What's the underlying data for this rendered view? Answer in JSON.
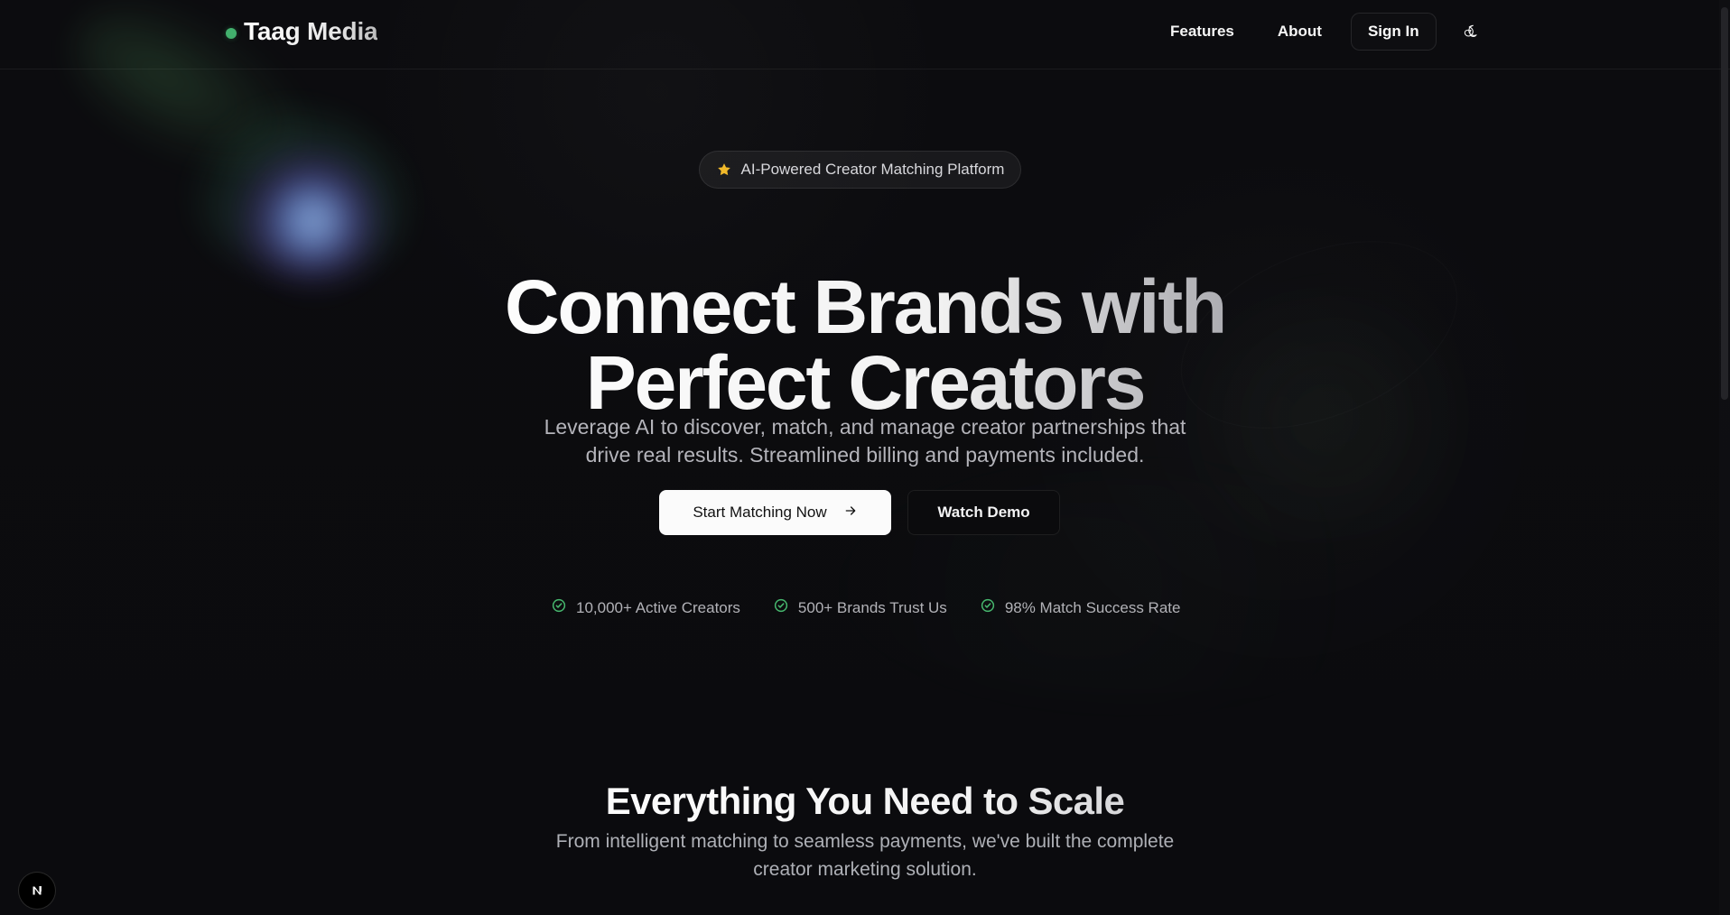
{
  "header": {
    "brand": "Taag Media",
    "nav_features": "Features",
    "nav_about": "About",
    "nav_signin": "Sign In",
    "theme_icon": "moon-icon"
  },
  "hero": {
    "badge_text": "AI-Powered Creator Matching Platform",
    "badge_icon": "star-icon",
    "title_line_1": "Connect Brands with",
    "title_line_2": "Perfect Creators",
    "subtitle_line_1": "Leverage AI to discover, match, and manage creator partnerships that",
    "subtitle_line_2": "drive real results. Streamlined billing and payments included.",
    "primary_cta": "Start Matching Now",
    "secondary_cta": "Watch Demo",
    "stats": [
      {
        "label": "10,000+ Active Creators"
      },
      {
        "label": "500+ Brands Trust Us"
      },
      {
        "label": "98% Match Success Rate"
      }
    ]
  },
  "features_intro": {
    "title": "Everything You Need to Scale",
    "subtitle_line_1": "From intelligent matching to seamless payments, we've built the complete",
    "subtitle_line_2": "creator marketing solution."
  },
  "floating": {
    "badge_letter": "N"
  },
  "colors": {
    "accent_green": "#42b06d",
    "star_yellow": "#f1b92a",
    "check_green": "#47b86e"
  }
}
